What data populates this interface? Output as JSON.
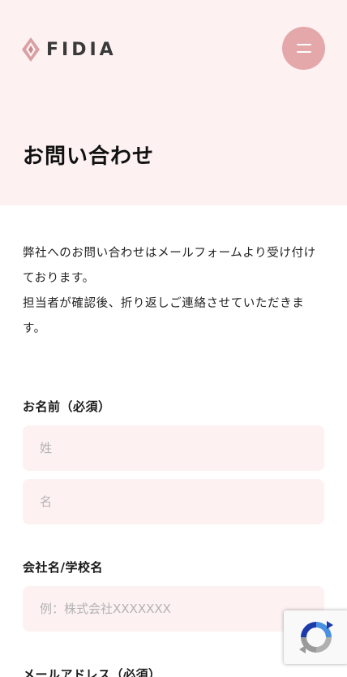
{
  "header": {
    "logo_text": "FIDIA",
    "logo_icon": "diamond-logo-icon",
    "menu_icon": "hamburger-menu-icon",
    "page_title": "お問い合わせ"
  },
  "intro": {
    "line1": "弊社へのお問い合わせはメールフォームより受け付けております。",
    "line2": "担当者が確認後、折り返しご連絡させていただきます。"
  },
  "form": {
    "name": {
      "label": "お名前（必須）",
      "last_placeholder": "姓",
      "first_placeholder": "名"
    },
    "company": {
      "label": "会社名/学校名",
      "placeholder": "例：株式会社XXXXXXX"
    },
    "email": {
      "label": "メールアドレス（必須）"
    }
  },
  "recaptcha": {
    "icon": "recaptcha-icon"
  },
  "colors": {
    "hero_bg": "#fdf1f2",
    "accent": "#e4a8ab",
    "input_bg": "#fdf1f2",
    "logo_mark": "#d9a0a3"
  }
}
